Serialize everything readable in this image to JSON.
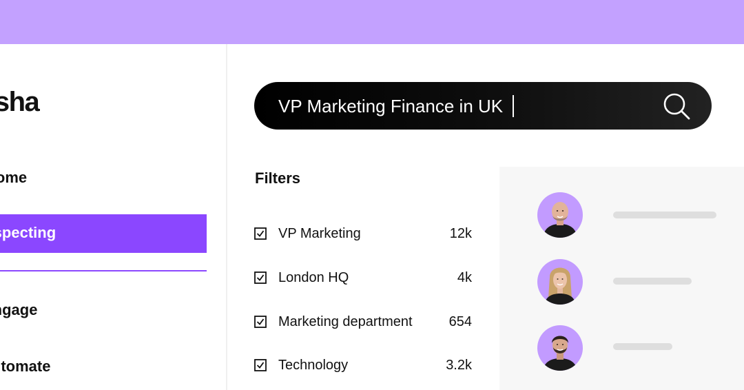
{
  "app": {
    "logo_text": "Lusha"
  },
  "sidebar": {
    "items": [
      {
        "label": "Home"
      },
      {
        "label": "Prospecting",
        "active": true
      },
      {
        "label": "Engage"
      },
      {
        "label": "Automate"
      }
    ]
  },
  "search": {
    "value": "VP Marketing Finance in UK",
    "icon": "search-icon"
  },
  "filters": {
    "title": "Filters",
    "items": [
      {
        "label": "VP Marketing",
        "count": "12k",
        "checked": true
      },
      {
        "label": "London HQ",
        "count": "4k",
        "checked": true
      },
      {
        "label": "Marketing department",
        "count": "654",
        "checked": true
      },
      {
        "label": "Technology",
        "count": "3.2k",
        "checked": true
      }
    ]
  },
  "results": {
    "count_shown": 3,
    "avatars": [
      "avatar-bald-man",
      "avatar-blonde-woman",
      "avatar-bearded-man"
    ]
  },
  "colors": {
    "topbar": "#c3a1ff",
    "accent": "#8b47ff",
    "avatar_bg": "#c29bff",
    "search_bg": "#000000"
  }
}
